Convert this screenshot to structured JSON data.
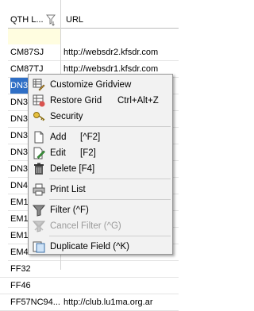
{
  "header": {
    "col_qth": "QTH L...",
    "col_url": "URL"
  },
  "rows": [
    {
      "qth": "CM87SJ",
      "url": "http://websdr2.kfsdr.com"
    },
    {
      "qth": "CM87TJ",
      "url": "http://websdr1.kfsdr.com"
    },
    {
      "qth": "DN3",
      "url": ""
    },
    {
      "qth": "DN3",
      "url": ""
    },
    {
      "qth": "DN3",
      "url": ""
    },
    {
      "qth": "DN3",
      "url": ""
    },
    {
      "qth": "DN3",
      "url": ""
    },
    {
      "qth": "DN3",
      "url": ""
    },
    {
      "qth": "DN4",
      "url": ""
    },
    {
      "qth": "EM1",
      "url": ""
    },
    {
      "qth": "EM1",
      "url": ""
    },
    {
      "qth": "EM1",
      "url": ""
    },
    {
      "qth": "EM4",
      "url": ""
    },
    {
      "qth": "FF32",
      "url": ""
    },
    {
      "qth": "FF46",
      "url": ""
    },
    {
      "qth": "FF57NC94...",
      "url": "http://club.lu1ma.org.ar"
    }
  ],
  "menu": {
    "customize": "Customize Gridview",
    "restore": "Restore Grid",
    "restore_sc": "Ctrl+Alt+Z",
    "security": "Security",
    "add": "Add",
    "add_sc": "[^F2]",
    "edit": "Edit",
    "edit_sc": "[F2]",
    "delete": "Delete [F4]",
    "print": "Print List",
    "filter": "Filter (^F)",
    "cancel_filter": "Cancel Filter (^G)",
    "duplicate": "Duplicate Field (^K)"
  },
  "colors": {
    "selection": "#2f6fc6",
    "filter_row": "#fffde0",
    "menu_bg": "#f2f2f2"
  }
}
